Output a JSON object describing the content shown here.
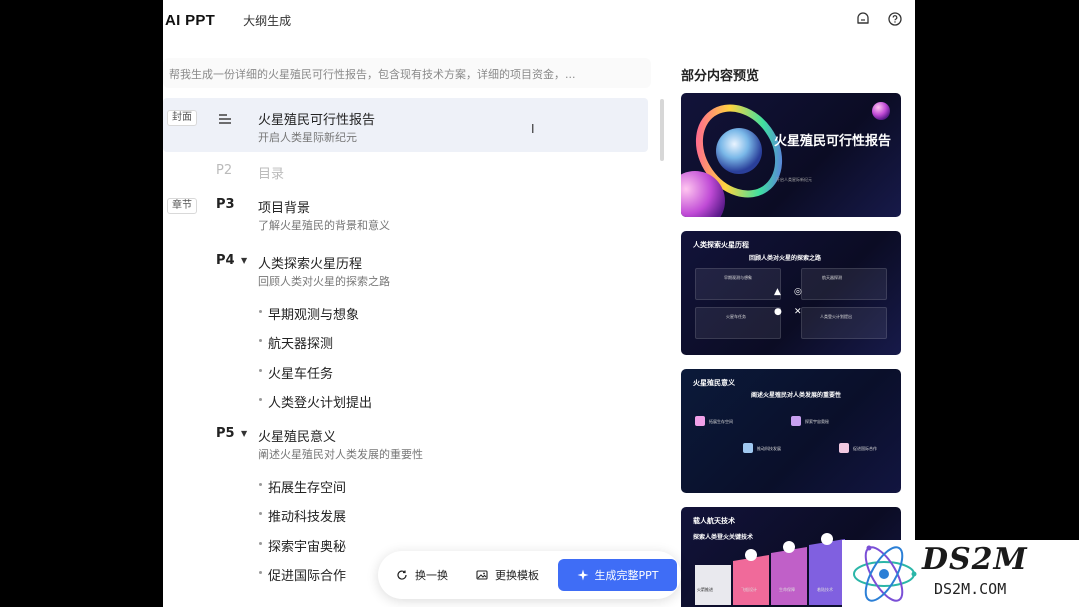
{
  "header": {
    "brand": "AI PPT",
    "title": "大纲生成",
    "icons": [
      "notification-icon",
      "help-icon"
    ]
  },
  "prompt": {
    "value": "帮我生成一份详细的火星殖民可行性报告，包含现有技术方案，详细的项目资金，..."
  },
  "outline": {
    "cover": {
      "tag": "封面",
      "title": "火星殖民可行性报告",
      "subtitle": "开启人类星际新纪元"
    },
    "p2": {
      "num": "P2",
      "title": "目录"
    },
    "p3": {
      "tag": "章节",
      "num": "P3",
      "title": "项目背景",
      "subtitle": "了解火星殖民的背景和意义"
    },
    "p4": {
      "num": "P4",
      "title": "人类探索火星历程",
      "subtitle": "回顾人类对火星的探索之路",
      "bullets": [
        "早期观测与想象",
        "航天器探测",
        "火星车任务",
        "人类登火计划提出"
      ]
    },
    "p5": {
      "num": "P5",
      "title": "火星殖民意义",
      "subtitle": "阐述火星殖民对人类发展的重要性",
      "bullets": [
        "拓展生存空间",
        "推动科技发展",
        "探索宇宙奥秘",
        "促进国际合作"
      ]
    }
  },
  "preview": {
    "title": "部分内容预览",
    "slide1": {
      "title": "火星殖民可行性报告",
      "subtitle": "开启人类星际新纪元"
    },
    "slide2": {
      "title": "人类探索火星历程",
      "subtitle": "回顾人类对火星的探索之路",
      "cards": [
        "早期观测与想象",
        "航天器探测",
        "火星车任务",
        "人类登火计划提出"
      ]
    },
    "slide3": {
      "title": "火星殖民意义",
      "subtitle": "阐述火星殖民对人类发展的重要性",
      "cards": [
        "拓展生存空间",
        "推动科技发展",
        "探索宇宙奥秘",
        "促进国际合作"
      ]
    },
    "slide4": {
      "title": "载人航天技术",
      "subtitle": "探索人类登火关键技术",
      "cards": [
        "火箭推进",
        "飞船设计",
        "生命保障",
        "着陆技术"
      ]
    }
  },
  "toolbar": {
    "swap_label": "换一换",
    "template_label": "更换模板",
    "generate_label": "生成完整PPT"
  },
  "watermark": {
    "logo_text": "DS2M",
    "url": "DS2M.COM"
  },
  "colors": {
    "accent": "#3f6df6",
    "slide_bg": "#0f1035"
  }
}
